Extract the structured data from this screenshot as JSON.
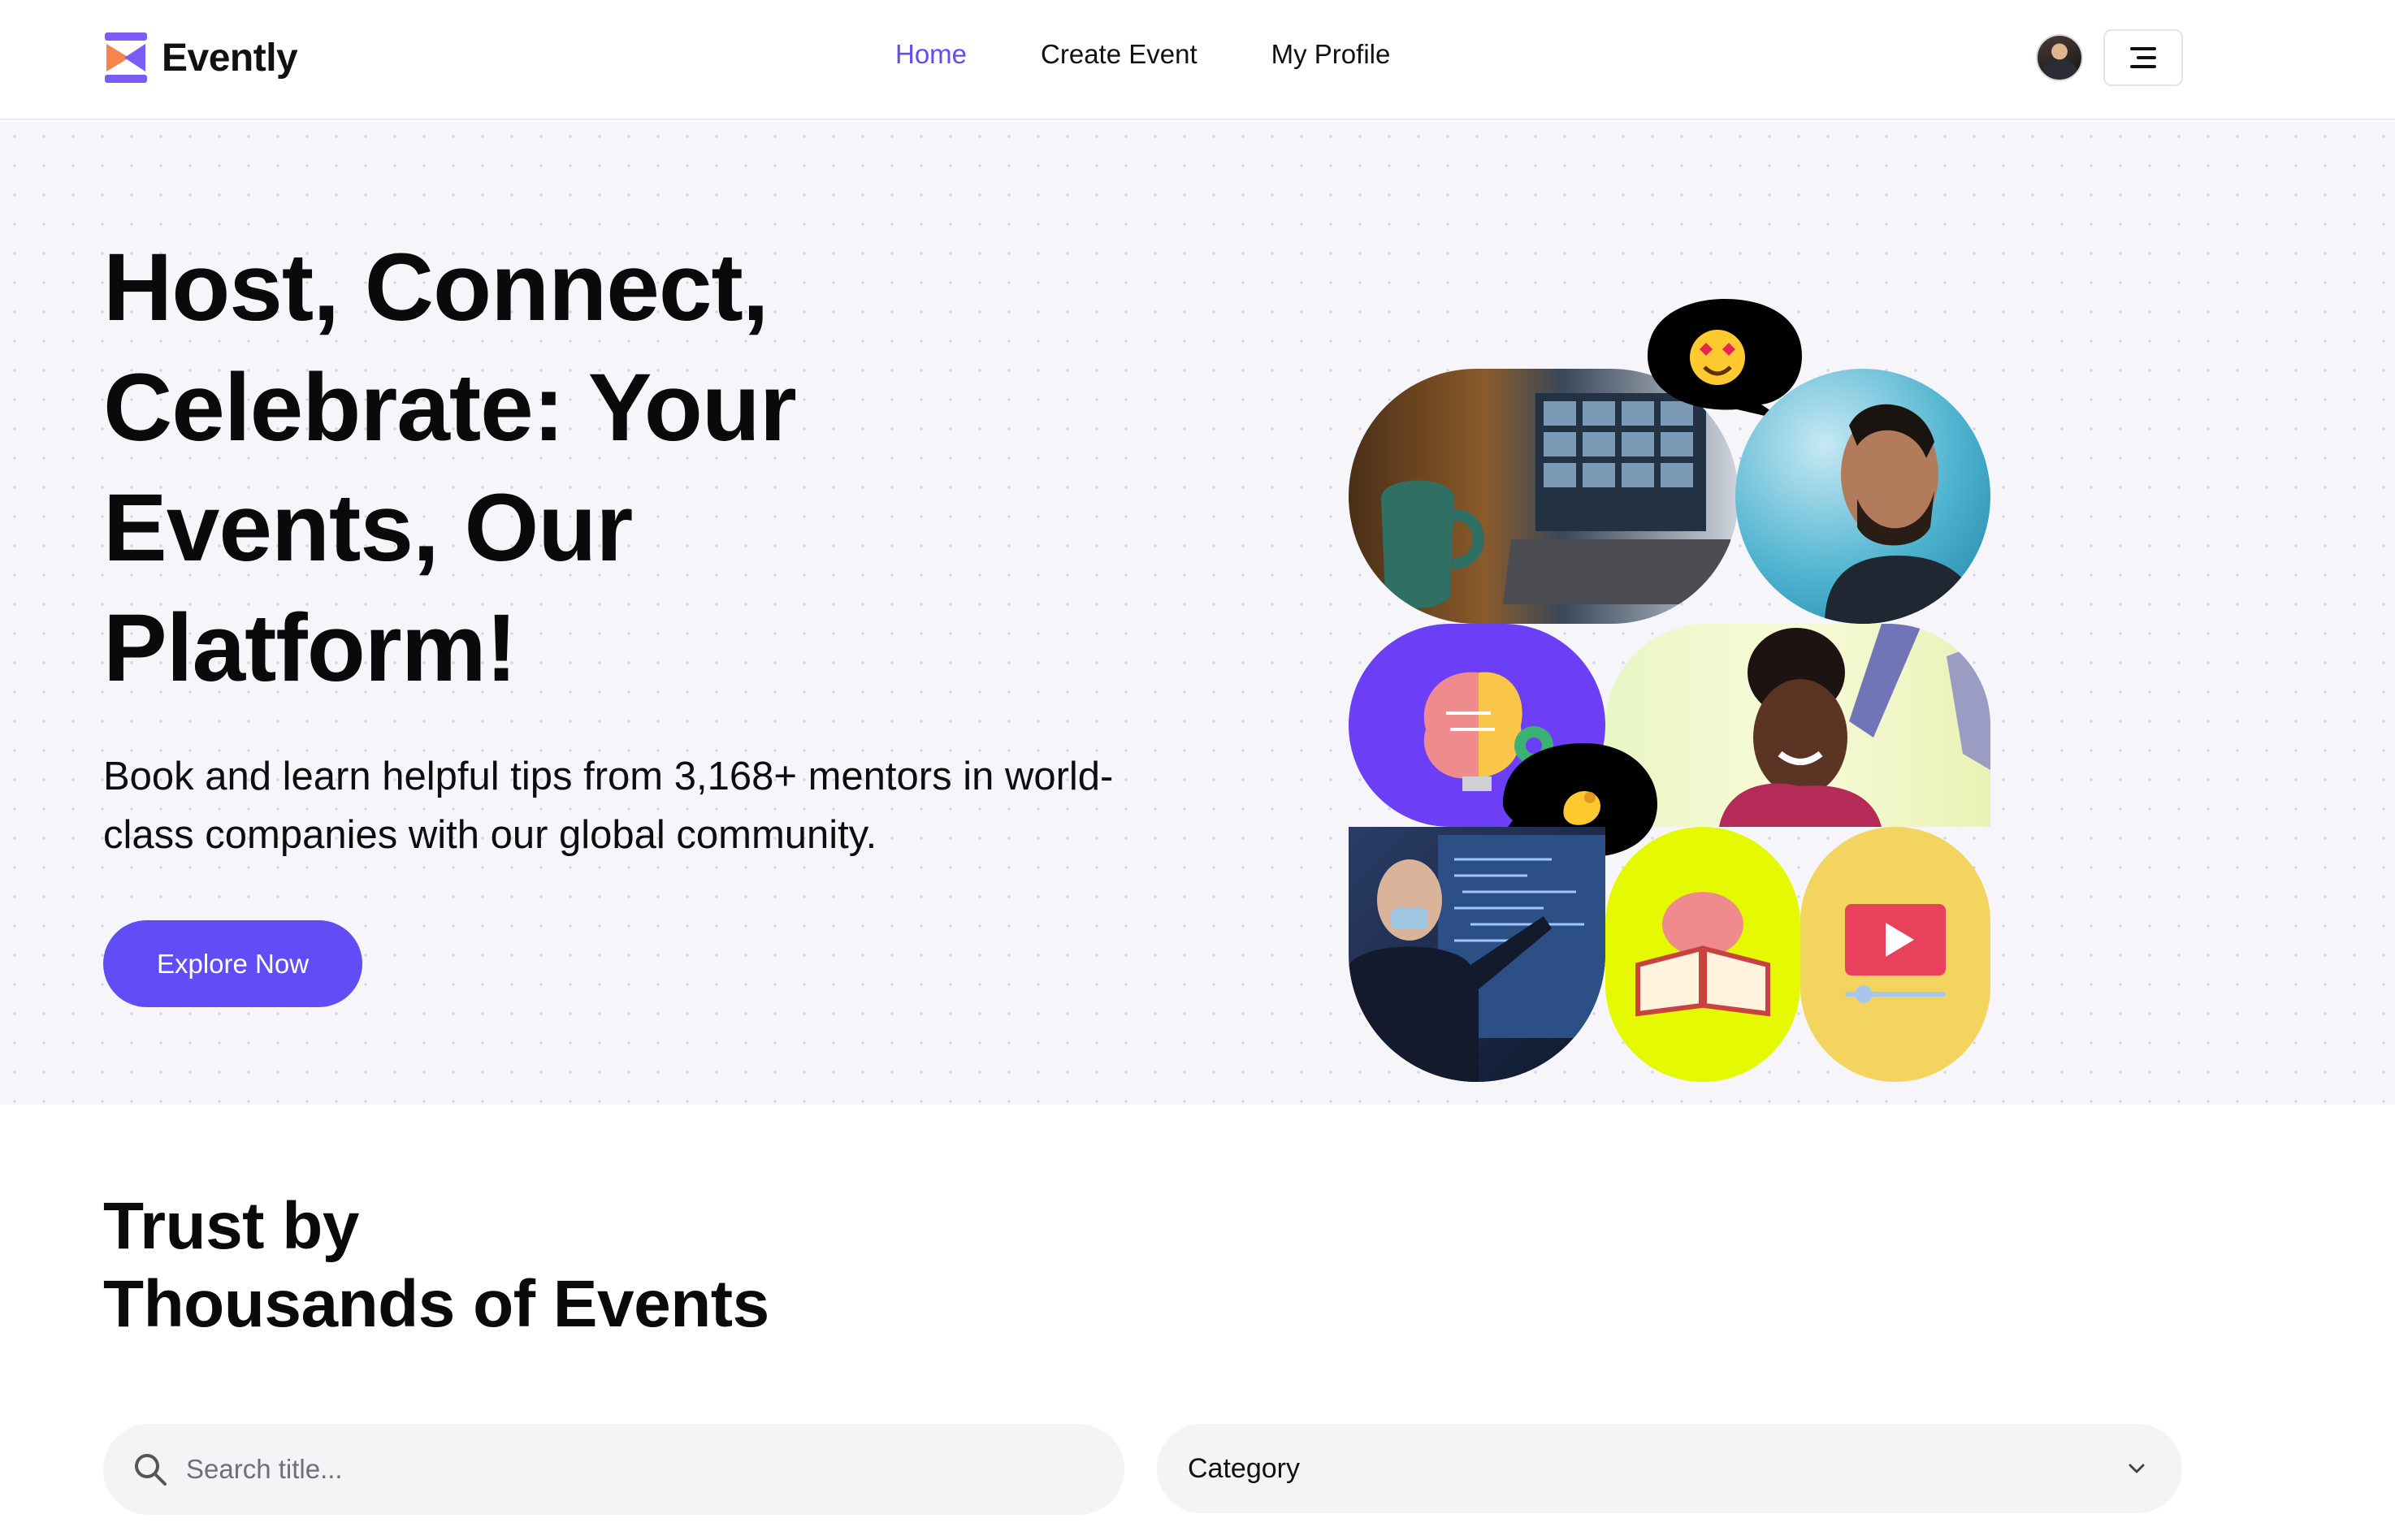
{
  "header": {
    "brand": "Evently",
    "nav": [
      {
        "label": "Home",
        "active": true
      },
      {
        "label": "Create Event",
        "active": false
      },
      {
        "label": "My Profile",
        "active": false
      }
    ],
    "avatar_icon": "user-avatar",
    "menu_icon": "hamburger-menu-icon"
  },
  "hero": {
    "title": "Host, Connect, Celebrate: Your Events, Our Platform!",
    "subtitle": "Book and learn helpful tips from 3,168+ mentors in world-class companies with our global community.",
    "cta_label": "Explore Now"
  },
  "trust": {
    "title_line1": "Trust by",
    "title_line2": "Thousands of Events"
  },
  "filters": {
    "search_placeholder": "Search title...",
    "category_label": "Category",
    "category_icon": "chevron-down-icon"
  },
  "colors": {
    "accent": "#624cf5",
    "hero_bg": "#f5f5fa",
    "logo_orange": "#f7844d",
    "tile_purple": "#6c3ef5",
    "tile_lime": "#e5fa00",
    "tile_yellow": "#f3d45e"
  }
}
